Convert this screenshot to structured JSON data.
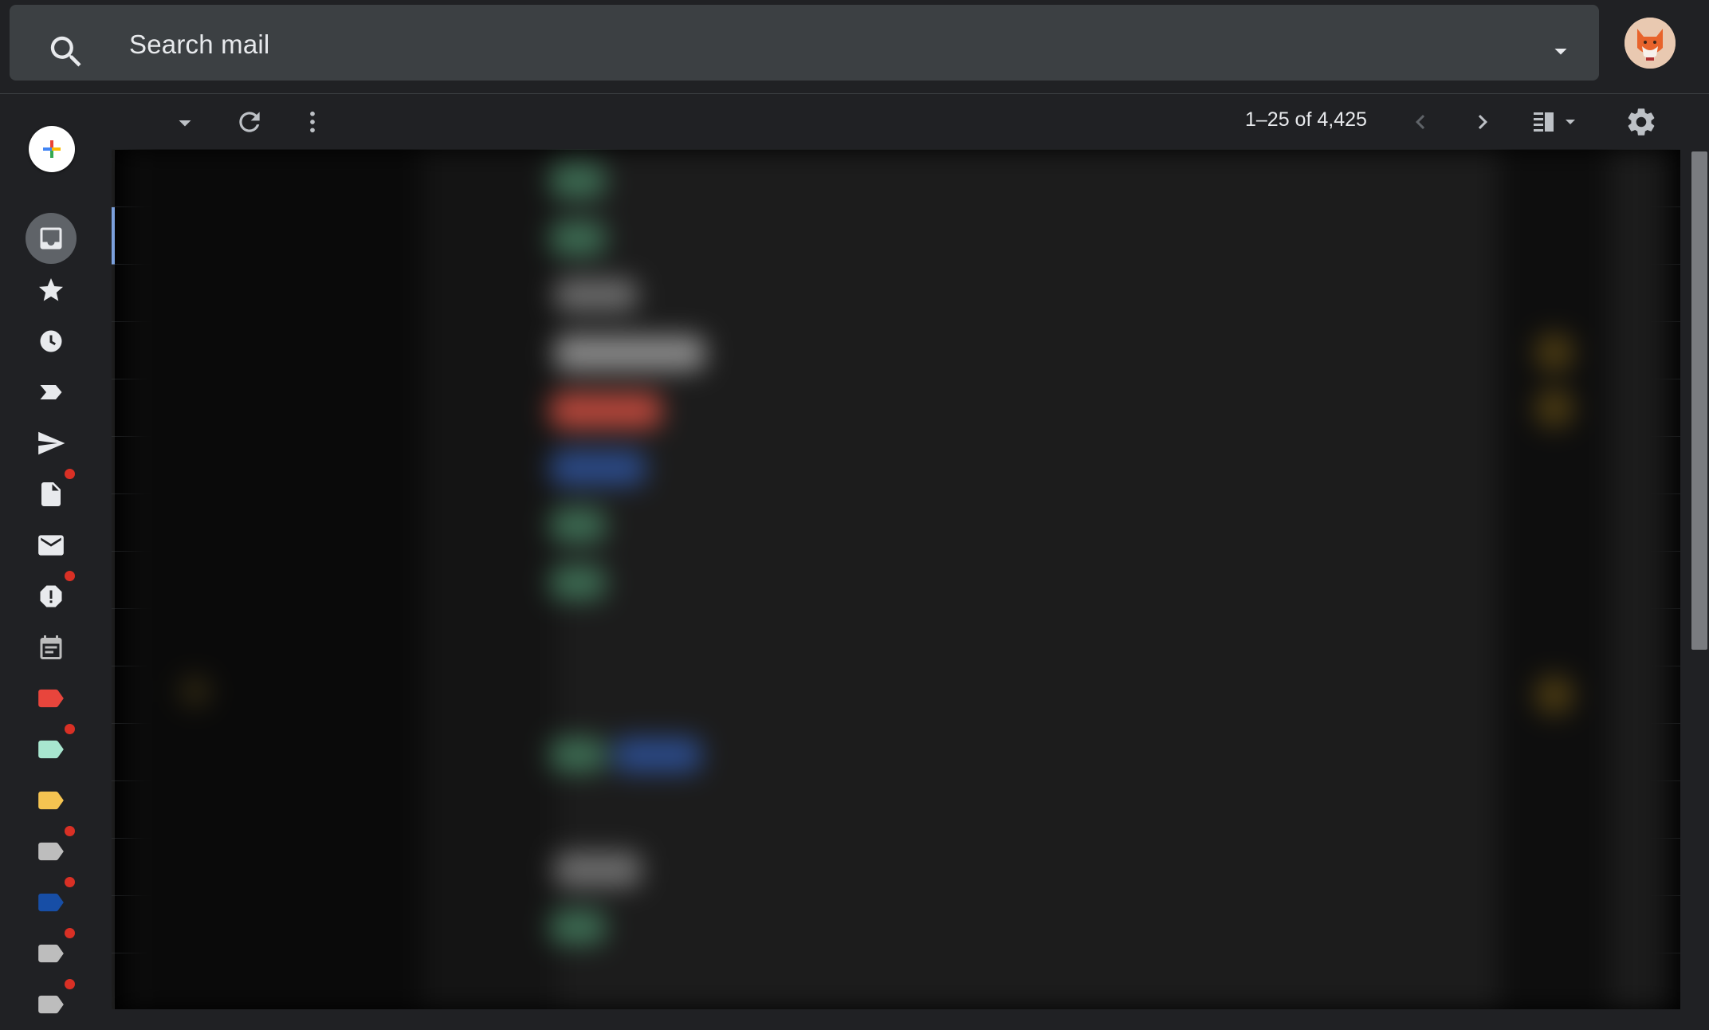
{
  "search": {
    "placeholder": "Search mail"
  },
  "toolbar": {
    "pagination_text": "1–25 of 4,425"
  },
  "icons": {
    "search": "search-icon",
    "search_options": "caret-down-icon",
    "select_menu": "caret-down-icon",
    "refresh": "refresh-icon",
    "more": "more-vert-icon",
    "prev_page": "chevron-left-icon",
    "next_page": "chevron-right-icon",
    "split_view": "split-pane-icon",
    "settings": "gear-icon"
  },
  "sidebar": {
    "items": [
      {
        "name": "inbox",
        "icon": "inbox-icon",
        "active": true,
        "dot": false
      },
      {
        "name": "starred",
        "icon": "star-icon",
        "active": false,
        "dot": false
      },
      {
        "name": "snoozed",
        "icon": "clock-icon",
        "active": false,
        "dot": false
      },
      {
        "name": "important",
        "icon": "important-label-icon",
        "active": false,
        "dot": false
      },
      {
        "name": "sent",
        "icon": "send-icon",
        "active": false,
        "dot": false
      },
      {
        "name": "drafts",
        "icon": "draft-icon",
        "active": false,
        "dot": true
      },
      {
        "name": "all-mail",
        "icon": "mail-icon",
        "active": false,
        "dot": false
      },
      {
        "name": "spam",
        "icon": "report-icon",
        "active": false,
        "dot": true
      },
      {
        "name": "scheduled",
        "icon": "calendar-note-icon",
        "active": false,
        "dot": false
      },
      {
        "name": "label-red",
        "icon": "label-icon",
        "color": "#e8453c",
        "dot": false
      },
      {
        "name": "label-mint",
        "icon": "label-icon",
        "color": "#a8e6cf",
        "dot": true
      },
      {
        "name": "label-yellow",
        "icon": "label-icon",
        "color": "#f5c451",
        "dot": false
      },
      {
        "name": "label-grey-1",
        "icon": "label-icon",
        "color": "#bdbdbd",
        "dot": true
      },
      {
        "name": "label-blue",
        "icon": "label-icon",
        "color": "#174ea6",
        "dot": true
      },
      {
        "name": "label-grey-2",
        "icon": "label-icon",
        "color": "#bdbdbd",
        "dot": true
      },
      {
        "name": "label-grey-3",
        "icon": "label-icon",
        "color": "#bdbdbd",
        "dot": true
      }
    ]
  },
  "colors": {
    "background": "#202124",
    "search_bar": "#3c4043",
    "active_rail": "#5f6368",
    "notification_dot": "#d93025",
    "selected_row_accent": "#8ab4f8"
  }
}
